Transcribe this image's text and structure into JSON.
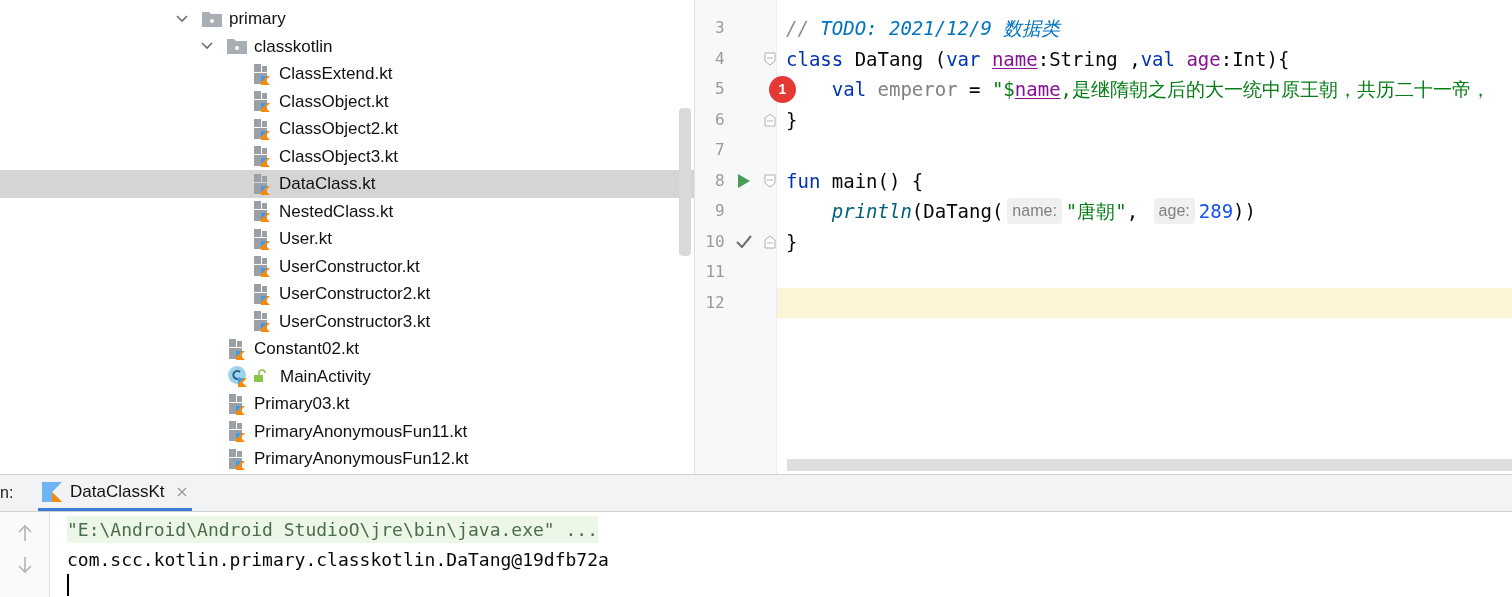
{
  "project_tree": {
    "items": [
      {
        "label": "primary",
        "kind": "folder",
        "expanded": true,
        "selected": false,
        "children": [
          {
            "label": "classkotlin",
            "kind": "folder",
            "expanded": true,
            "selected": false,
            "children": [
              {
                "label": "ClassExtend.kt",
                "kind": "kotlin_file",
                "selected": false
              },
              {
                "label": "ClassObject.kt",
                "kind": "kotlin_file",
                "selected": false
              },
              {
                "label": "ClassObject2.kt",
                "kind": "kotlin_file",
                "selected": false
              },
              {
                "label": "ClassObject3.kt",
                "kind": "kotlin_file",
                "selected": false
              },
              {
                "label": "DataClass.kt",
                "kind": "kotlin_file",
                "selected": true
              },
              {
                "label": "NestedClass.kt",
                "kind": "kotlin_file",
                "selected": false
              },
              {
                "label": "User.kt",
                "kind": "kotlin_file",
                "selected": false
              },
              {
                "label": "UserConstructor.kt",
                "kind": "kotlin_file",
                "selected": false
              },
              {
                "label": "UserConstructor2.kt",
                "kind": "kotlin_file",
                "selected": false
              },
              {
                "label": "UserConstructor3.kt",
                "kind": "kotlin_file",
                "selected": false
              }
            ]
          },
          {
            "label": "Constant02.kt",
            "kind": "kotlin_file",
            "selected": false
          },
          {
            "label": "MainActivity",
            "kind": "activity",
            "selected": false
          },
          {
            "label": "Primary03.kt",
            "kind": "kotlin_file",
            "selected": false
          },
          {
            "label": "PrimaryAnonymousFun11.kt",
            "kind": "kotlin_file",
            "selected": false
          },
          {
            "label": "PrimaryAnonymousFun12.kt",
            "kind": "kotlin_file",
            "selected": false
          }
        ]
      }
    ]
  },
  "editor": {
    "lines": [
      {
        "number": "3",
        "current": false,
        "tokens": [
          {
            "text": "// ",
            "kind": "comment"
          },
          {
            "text": "TODO: 2021/12/9 数据类",
            "kind": "todo"
          }
        ]
      },
      {
        "number": "4",
        "current": false,
        "gutter_marks": [
          {
            "kind": "fold_start"
          }
        ],
        "tokens": [
          {
            "text": "class",
            "kind": "keyword"
          },
          {
            "text": " DaTang (",
            "kind": "plain"
          },
          {
            "text": "var ",
            "kind": "keyword"
          },
          {
            "text": "name",
            "kind": "ref"
          },
          {
            "text": ":String ,",
            "kind": "plain"
          },
          {
            "text": "val ",
            "kind": "keyword"
          },
          {
            "text": "age",
            "kind": "param"
          },
          {
            "text": ":Int){",
            "kind": "plain"
          }
        ]
      },
      {
        "number": "5",
        "current": false,
        "gutter_marks": [
          {
            "kind": "error",
            "badge": "1"
          }
        ],
        "tokens": [
          {
            "text": "    val ",
            "kind": "keyword"
          },
          {
            "text": "emperor",
            "kind": "unused"
          },
          {
            "text": " = ",
            "kind": "plain"
          },
          {
            "text": "\"$",
            "kind": "string"
          },
          {
            "text": "name",
            "kind": "ref"
          },
          {
            "text": ",是继隋朝之后的大一统中原王朝，共历二十一帝，",
            "kind": "string"
          }
        ]
      },
      {
        "number": "6",
        "current": false,
        "gutter_marks": [
          {
            "kind": "fold_end"
          }
        ],
        "tokens": [
          {
            "text": "}",
            "kind": "plain"
          }
        ]
      },
      {
        "number": "7",
        "current": false
      },
      {
        "number": "8",
        "current": false,
        "gutter_marks": [
          {
            "kind": "run"
          },
          {
            "kind": "fold_start"
          }
        ],
        "tokens": [
          {
            "text": "fun ",
            "kind": "keyword"
          },
          {
            "text": "main() {",
            "kind": "plain"
          }
        ]
      },
      {
        "number": "9",
        "current": false,
        "tokens": [
          {
            "text": "    println",
            "kind": "call"
          },
          {
            "text": "(DaTang(",
            "kind": "plain"
          },
          {
            "text": "name:",
            "kind": "hint"
          },
          {
            "text": "\"唐朝\"",
            "kind": "string"
          },
          {
            "text": ", ",
            "kind": "plain"
          },
          {
            "text": "age:",
            "kind": "hint"
          },
          {
            "text": "289",
            "kind": "number"
          },
          {
            "text": "))",
            "kind": "plain"
          }
        ]
      },
      {
        "number": "10",
        "current": false,
        "gutter_marks": [
          {
            "kind": "check"
          },
          {
            "kind": "fold_end"
          }
        ],
        "tokens": [
          {
            "text": "}",
            "kind": "plain"
          }
        ]
      },
      {
        "number": "11",
        "current": false
      },
      {
        "number": "12",
        "current": true
      }
    ]
  },
  "run_panel": {
    "label": "n:",
    "tabs": [
      {
        "label": "DataClassKt",
        "selected": true
      }
    ],
    "output": [
      {
        "text": "\"E:\\Android\\Android StudioO\\jre\\bin\\java.exe\" ...",
        "kind": "command"
      },
      {
        "text": "com.scc.kotlin.primary.classkotlin.DaTang@19dfb72a",
        "kind": "plain"
      }
    ]
  }
}
